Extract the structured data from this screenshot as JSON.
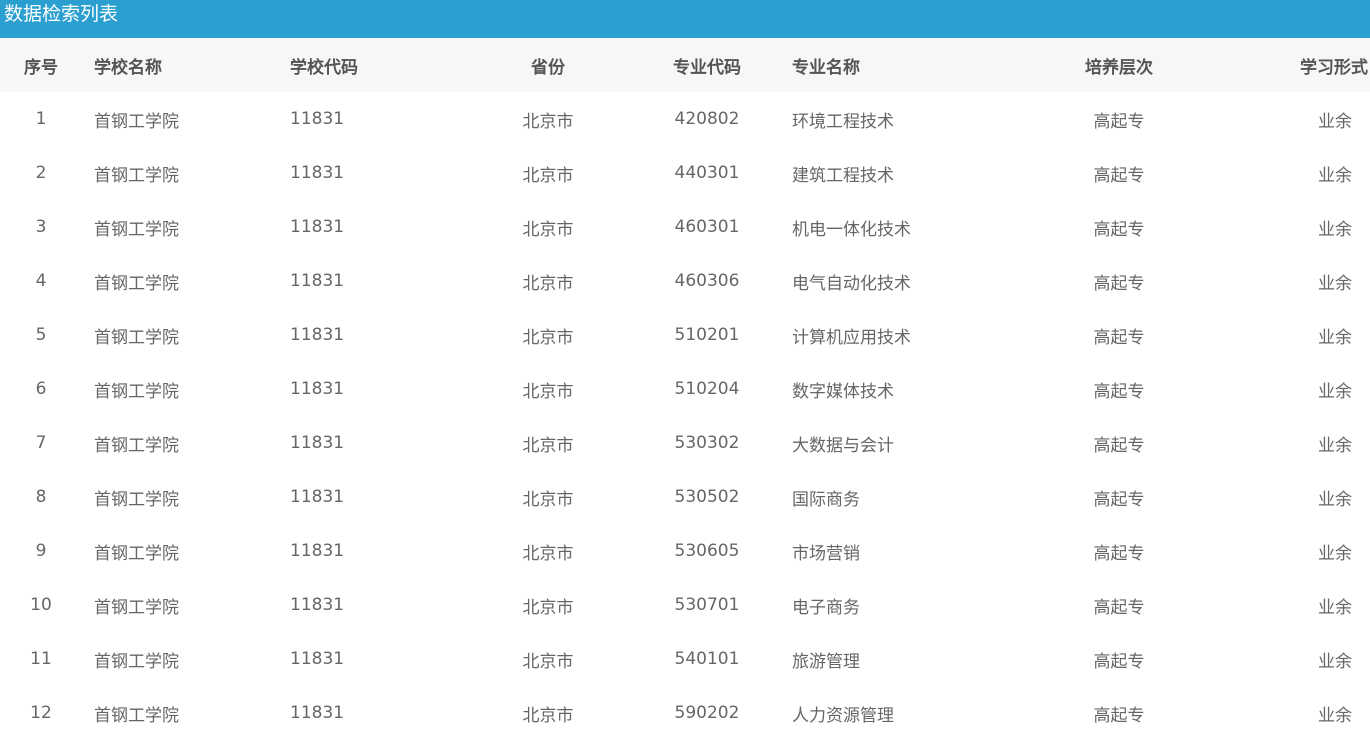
{
  "page": {
    "title": "数据检索列表"
  },
  "table": {
    "headers": {
      "idx": "序号",
      "school": "学校名称",
      "school_code": "学校代码",
      "province": "省份",
      "major_code": "专业代码",
      "major_name": "专业名称",
      "level": "培养层次",
      "study_form": "学习形式"
    },
    "rows": [
      {
        "idx": "1",
        "school": "首钢工学院",
        "school_code": "11831",
        "province": "北京市",
        "major_code": "420802",
        "major_name": "环境工程技术",
        "level": "高起专",
        "study_form": "业余"
      },
      {
        "idx": "2",
        "school": "首钢工学院",
        "school_code": "11831",
        "province": "北京市",
        "major_code": "440301",
        "major_name": "建筑工程技术",
        "level": "高起专",
        "study_form": "业余"
      },
      {
        "idx": "3",
        "school": "首钢工学院",
        "school_code": "11831",
        "province": "北京市",
        "major_code": "460301",
        "major_name": "机电一体化技术",
        "level": "高起专",
        "study_form": "业余"
      },
      {
        "idx": "4",
        "school": "首钢工学院",
        "school_code": "11831",
        "province": "北京市",
        "major_code": "460306",
        "major_name": "电气自动化技术",
        "level": "高起专",
        "study_form": "业余"
      },
      {
        "idx": "5",
        "school": "首钢工学院",
        "school_code": "11831",
        "province": "北京市",
        "major_code": "510201",
        "major_name": "计算机应用技术",
        "level": "高起专",
        "study_form": "业余"
      },
      {
        "idx": "6",
        "school": "首钢工学院",
        "school_code": "11831",
        "province": "北京市",
        "major_code": "510204",
        "major_name": "数字媒体技术",
        "level": "高起专",
        "study_form": "业余"
      },
      {
        "idx": "7",
        "school": "首钢工学院",
        "school_code": "11831",
        "province": "北京市",
        "major_code": "530302",
        "major_name": "大数据与会计",
        "level": "高起专",
        "study_form": "业余"
      },
      {
        "idx": "8",
        "school": "首钢工学院",
        "school_code": "11831",
        "province": "北京市",
        "major_code": "530502",
        "major_name": "国际商务",
        "level": "高起专",
        "study_form": "业余"
      },
      {
        "idx": "9",
        "school": "首钢工学院",
        "school_code": "11831",
        "province": "北京市",
        "major_code": "530605",
        "major_name": "市场营销",
        "level": "高起专",
        "study_form": "业余"
      },
      {
        "idx": "10",
        "school": "首钢工学院",
        "school_code": "11831",
        "province": "北京市",
        "major_code": "530701",
        "major_name": "电子商务",
        "level": "高起专",
        "study_form": "业余"
      },
      {
        "idx": "11",
        "school": "首钢工学院",
        "school_code": "11831",
        "province": "北京市",
        "major_code": "540101",
        "major_name": "旅游管理",
        "level": "高起专",
        "study_form": "业余"
      },
      {
        "idx": "12",
        "school": "首钢工学院",
        "school_code": "11831",
        "province": "北京市",
        "major_code": "590202",
        "major_name": "人力资源管理",
        "level": "高起专",
        "study_form": "业余"
      }
    ]
  },
  "colors": {
    "title_bar": "#2a9fd0",
    "header_bg": "#f7f7f7",
    "header_text": "#555555",
    "cell_text": "#666666"
  }
}
